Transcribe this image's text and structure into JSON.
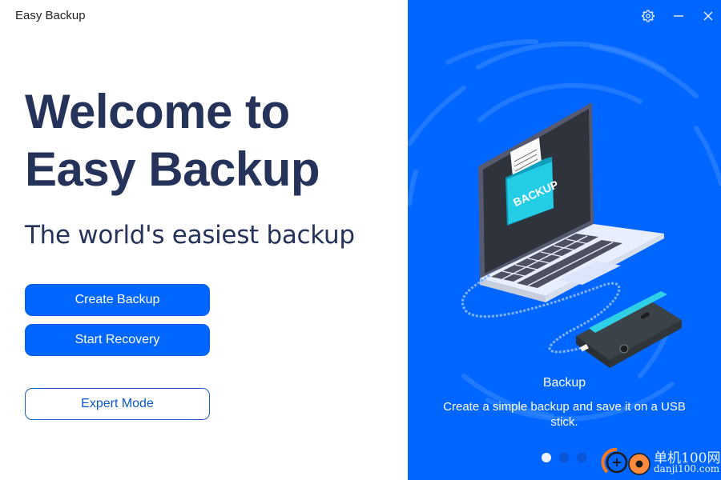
{
  "window": {
    "title": "Easy Backup",
    "controls": {
      "settings_icon": "gear-icon",
      "minimize_icon": "minimize-icon",
      "close_icon": "close-icon"
    }
  },
  "welcome": {
    "headline": "Welcome to Easy Backup",
    "tagline": "The world's easiest backup"
  },
  "actions": {
    "create_backup_label": "Create Backup",
    "start_recovery_label": "Start Recovery",
    "expert_mode_label": "Expert Mode"
  },
  "carousel": {
    "illustration_label": "BACKUP",
    "slide_title": "Backup",
    "slide_description": "Create a simple backup and save it on a USB stick.",
    "slide_count": 3,
    "active_index": 0
  },
  "watermark": {
    "line1": "单机100网",
    "line2": "danji100.com"
  },
  "colors": {
    "accent": "#0066ff",
    "headline": "#25335a",
    "outline_button_text": "#0a57c9"
  }
}
